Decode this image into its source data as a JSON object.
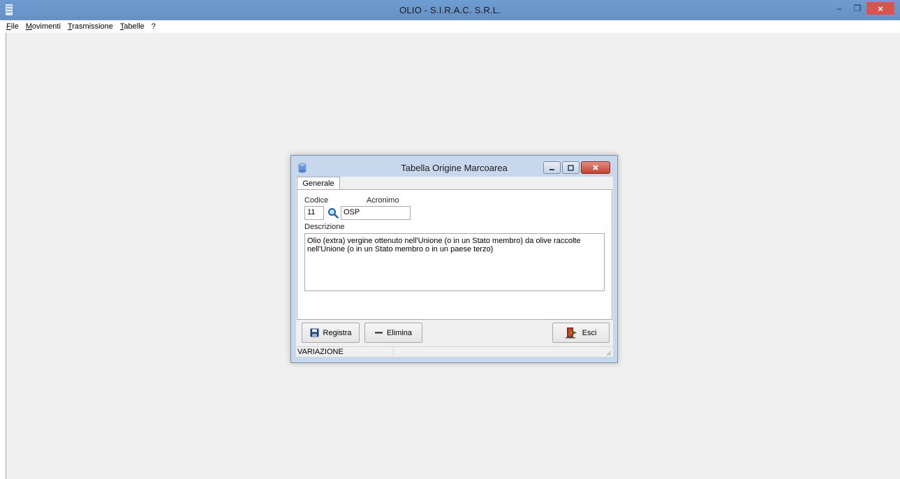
{
  "app": {
    "title": "OLIO - S.I.R.A.C. S.R.L.",
    "menu": [
      {
        "accel": "F",
        "rest": "ile"
      },
      {
        "accel": "M",
        "rest": "ovimenti"
      },
      {
        "accel": "T",
        "rest": "rasmissione"
      },
      {
        "accel": "T",
        "pre": "",
        "rest": "abelle"
      },
      {
        "accel": "",
        "rest": "?"
      }
    ],
    "minimize_glyph": "–",
    "restore_glyph": "❐",
    "close_glyph": "×"
  },
  "dialog": {
    "title": "Tabella Origine Marcoarea",
    "tab_label": "Generale",
    "codice_label": "Codice",
    "codice_value": "11",
    "acronimo_label": "Acronimo",
    "acronimo_value": "OSP",
    "descrizione_label": "Descrizione",
    "descrizione_value": "Olio (extra) vergine ottenuto nell'Unione (o in un Stato membro) da olive raccolte nell'Unione (o in un Stato membro o in un paese terzo)",
    "buttons": {
      "registra": "Registra",
      "elimina": "Elimina",
      "esci": "Esci"
    },
    "status_text": "VARIAZIONE"
  },
  "colors": {
    "app_titlebar": "#6f9cd0",
    "close_red": "#d9534f",
    "dialog_frame": "#c7d8ec",
    "client_bg": "#f0f0f0"
  },
  "icons": {
    "app": "database-icon",
    "lookup": "magnifier-icon",
    "save": "floppy-disk-icon",
    "delete": "minus-icon",
    "exit": "exit-door-icon"
  }
}
